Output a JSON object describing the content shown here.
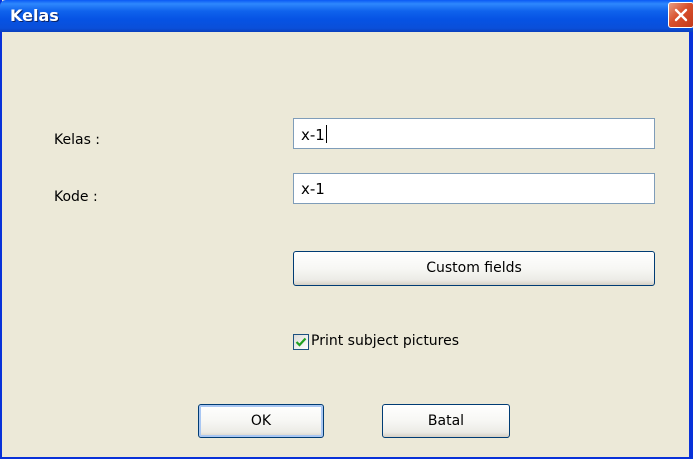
{
  "window": {
    "title": "Kelas",
    "close_icon": "close-icon",
    "colors": {
      "titlebar": "#0a59f5",
      "close": "#d9502c",
      "body": "#ece9d8"
    }
  },
  "form": {
    "kelas_label": "Kelas :",
    "kelas_value": "x-1",
    "kode_label": "Kode :",
    "kode_value": "x-1",
    "custom_fields_label": "Custom fields",
    "print_pictures_label": "Print subject pictures",
    "print_pictures_checked": true,
    "check_icon": "checkmark-icon"
  },
  "buttons": {
    "ok_label": "OK",
    "cancel_label": "Batal"
  }
}
